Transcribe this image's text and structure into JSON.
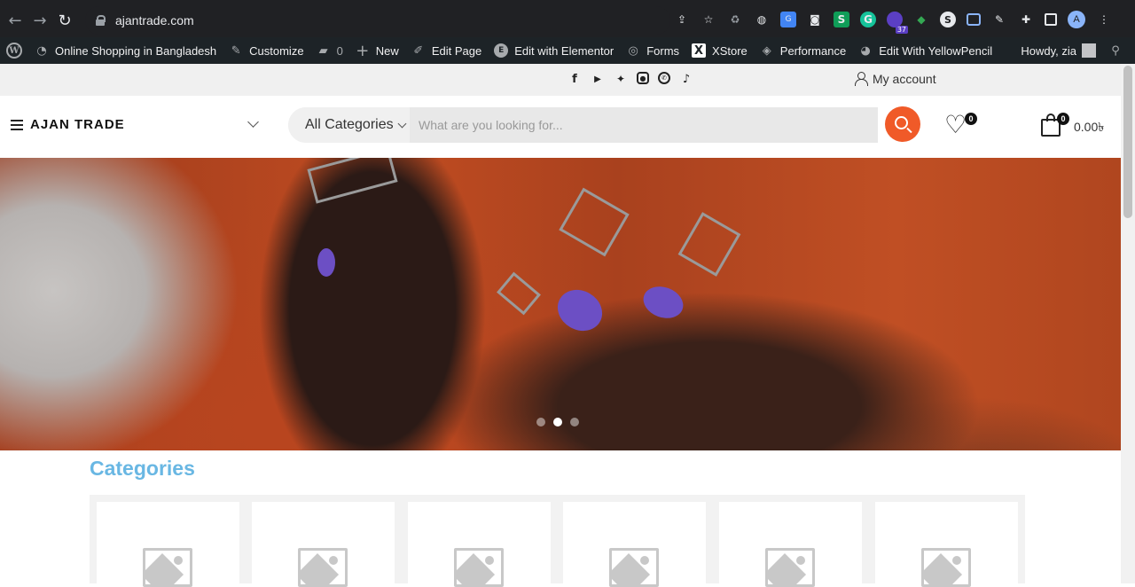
{
  "browser": {
    "url": "ajantrade.com",
    "extension_badge": "37",
    "profile_initial": "A"
  },
  "admin_bar": {
    "site_name": "Online Shopping in Bangladesh",
    "customize": "Customize",
    "comments_count": "0",
    "new": "New",
    "edit_page": "Edit Page",
    "edit_elementor": "Edit with Elementor",
    "forms": "Forms",
    "xstore": "XStore",
    "performance": "Performance",
    "yellowpencil": "Edit With YellowPencil",
    "howdy": "Howdy, zia"
  },
  "topbar": {
    "social_icons": [
      "facebook-icon",
      "youtube-icon",
      "twitter-icon",
      "instagram-icon",
      "whatsapp-icon",
      "tiktok-icon"
    ],
    "my_account": "My account"
  },
  "header": {
    "brand": "AJAN TRADE",
    "category_select": "All Categories",
    "search_placeholder": "What are you looking for...",
    "wishlist_count": "0",
    "cart_count": "0",
    "cart_total": "0.00৳"
  },
  "hero": {
    "slide_count": 3,
    "active_slide": 2
  },
  "sections": {
    "categories_title": "Categories",
    "category_cards": 6
  },
  "colors": {
    "accent": "#f05a28",
    "categories_title": "#69b7e3",
    "admin_bar": "#1d2327",
    "browser_bar": "#202124"
  }
}
